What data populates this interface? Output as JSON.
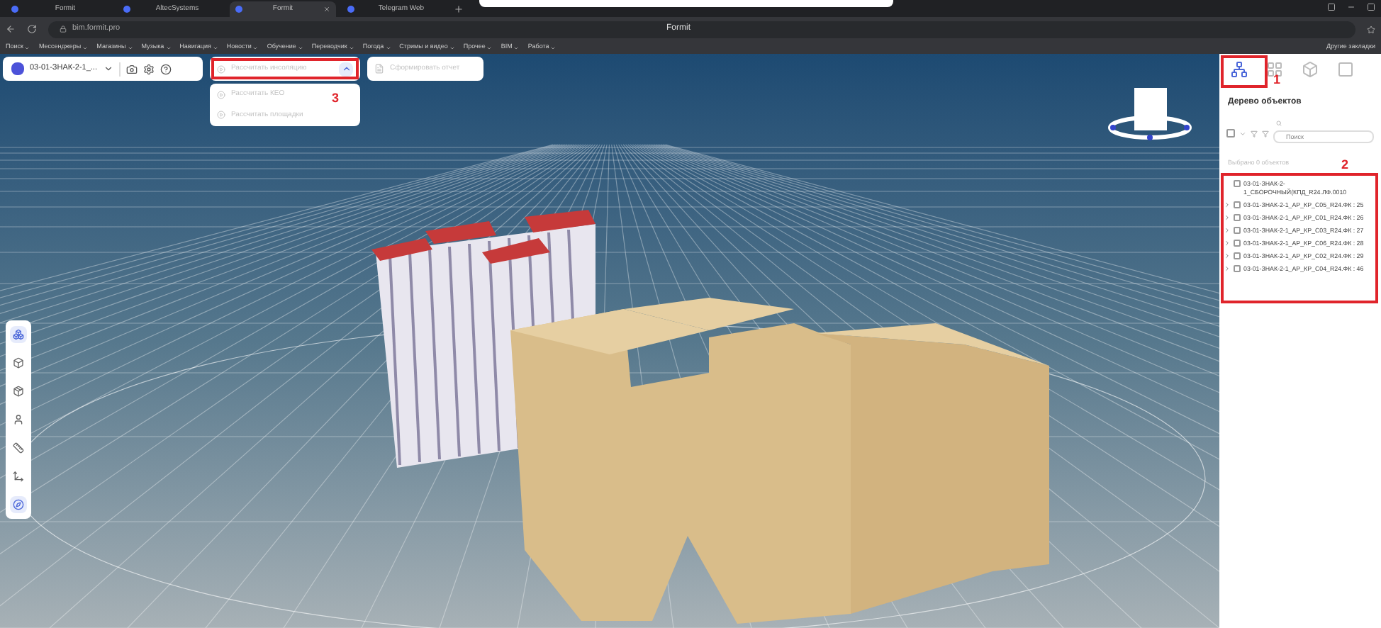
{
  "browser": {
    "tabs": [
      {
        "label": "Formit",
        "selected": false
      },
      {
        "label": "AltecSystems",
        "selected": false
      },
      {
        "label": "Formit",
        "selected": true
      },
      {
        "label": "Telegram Web",
        "selected": false
      }
    ],
    "url": "bim.formit.pro",
    "page_title": "Formit",
    "bookmarks": [
      "Поиск",
      "Мессенджеры",
      "Магазины",
      "Музыка",
      "Навигация",
      "Новости",
      "Обучение",
      "Переводчик",
      "Погода",
      "Стримы и видео",
      "Прочее",
      "BIM",
      "Работа"
    ],
    "other_bookmarks": "Другие закладки"
  },
  "model_bar": {
    "model_name": "03-01-ЗНАК-2-1_..."
  },
  "insolation": {
    "label": "Рассчитать инсоляцию",
    "disabled": true,
    "expanded": true,
    "items": [
      {
        "label": "Рассчитать КЕО",
        "disabled": true
      },
      {
        "label": "Рассчитать площадки",
        "disabled": true
      }
    ]
  },
  "report": {
    "label": "Сформировать отчет",
    "disabled": true
  },
  "left_tools": [
    {
      "selected": true
    },
    {
      "selected": false
    },
    {
      "selected": false
    },
    {
      "selected": false
    },
    {
      "selected": false
    },
    {
      "selected": false
    },
    {
      "selected": true
    }
  ],
  "panel": {
    "tabs": [
      {
        "selected": true
      },
      {
        "selected": false
      },
      {
        "selected": false
      },
      {
        "selected": false
      }
    ],
    "title": "Дерево объектов",
    "select_all_checked": false,
    "search_placeholder": "Поиск",
    "selection_count": "Выбрано 0 объектов",
    "tree": [
      {
        "kind": "leaf",
        "label": "03-01-ЗНАК-2-1_СБОРОЧНЫЙ(КПД_R24.ЛФ.0010",
        "checked": false
      },
      {
        "kind": "group",
        "label": "03-01-ЗНАК-2-1_АР_КР_С05_R24.ФК : 25",
        "checked": false,
        "expanded": false
      },
      {
        "kind": "group",
        "label": "03-01-ЗНАК-2-1_АР_КР_С01_R24.ФК : 26",
        "checked": false,
        "expanded": false
      },
      {
        "kind": "group",
        "label": "03-01-ЗНАК-2-1_АР_КР_С03_R24.ФК : 27",
        "checked": false,
        "expanded": false
      },
      {
        "kind": "group",
        "label": "03-01-ЗНАК-2-1_АР_КР_С06_R24.ФК : 28",
        "checked": false,
        "expanded": false
      },
      {
        "kind": "group",
        "label": "03-01-ЗНАК-2-1_АР_КР_С02_R24.ФК : 29",
        "checked": false,
        "expanded": false
      },
      {
        "kind": "group",
        "label": "03-01-ЗНАК-2-1_АР_КР_С04_R24.ФК : 46",
        "checked": false,
        "expanded": false
      }
    ]
  },
  "annotations": [
    "1",
    "2",
    "3"
  ]
}
